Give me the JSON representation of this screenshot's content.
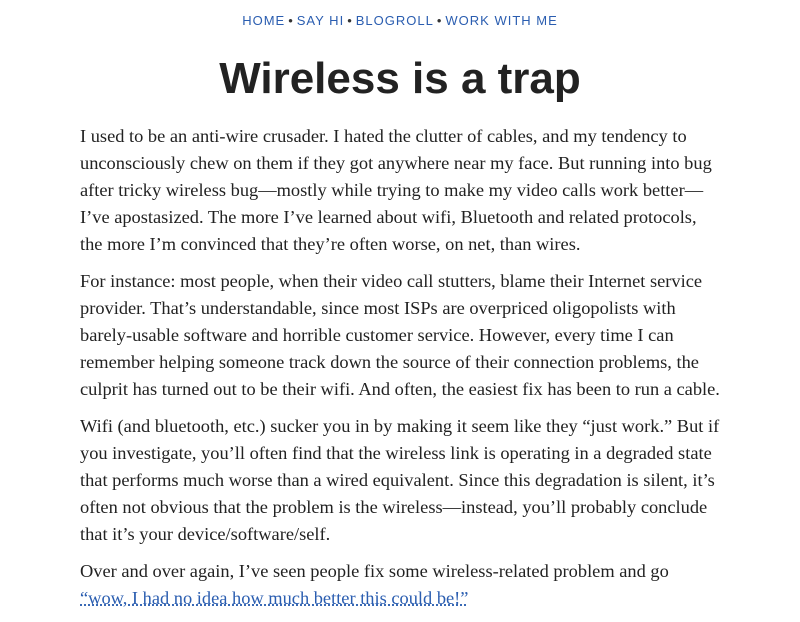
{
  "nav": {
    "items": [
      "HOME",
      "SAY HI",
      "BLOGROLL",
      "WORK WITH ME"
    ],
    "separator": "•"
  },
  "post": {
    "title": "Wireless is a trap",
    "paragraphs": [
      "I used to be an anti-wire crusader. I hated the clutter of cables, and my tendency to unconsciously chew on them if they got anywhere near my face. But running into bug after tricky wireless bug—mostly while trying to make my video calls work better—I’ve apostasized. The more I’ve learned about wifi, Bluetooth and related protocols, the more I’m convinced that they’re often worse, on net, than wires.",
      "For instance: most people, when their video call stutters, blame their Internet service provider. That’s understandable, since most ISPs are overpriced oligopolists with barely-usable software and horrible customer service. However, every time I can remember helping someone track down the source of their connection problems, the culprit has turned out to be their wifi. And often, the easiest fix has been to run a cable.",
      "Wifi (and bluetooth, etc.) sucker you in by making it seem like they “just work.” But if you investigate, you’ll often find that the wireless link is operating in a degraded state that performs much worse than a wired equivalent. Since this degradation is silent, it’s often not obvious that the problem is the wireless—instead, you’ll probably conclude that it’s your device/software/self."
    ],
    "last_paragraph_text": "Over and over again, I’ve seen people fix some wireless-related problem and go ",
    "last_paragraph_link": "“wow, I had no idea how much better this could be!”"
  },
  "colors": {
    "link": "#2a5db0",
    "text": "#222222",
    "background": "#ffffff"
  }
}
